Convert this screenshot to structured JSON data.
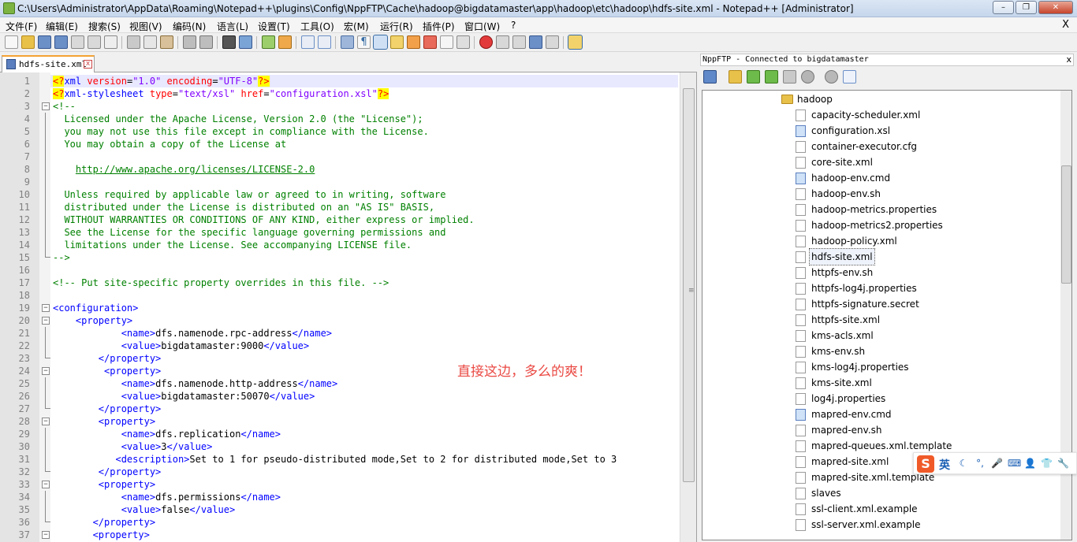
{
  "window": {
    "title": "C:\\Users\\Administrator\\AppData\\Roaming\\Notepad++\\plugins\\Config\\NppFTP\\Cache\\hadoop@bigdatamaster\\app\\hadoop\\etc\\hadoop\\hdfs-site.xml - Notepad++ [Administrator]",
    "minimize": "–",
    "maximize": "❐",
    "close": "✕"
  },
  "menu": {
    "items": [
      "文件(F)",
      "编辑(E)",
      "搜索(S)",
      "视图(V)",
      "编码(N)",
      "语言(L)",
      "设置(T)",
      "工具(O)",
      "宏(M)",
      "运行(R)",
      "插件(P)",
      "窗口(W)",
      "?"
    ],
    "close": "X"
  },
  "tab": {
    "label": "hdfs-site.xml",
    "close": "x"
  },
  "editor": {
    "lines": [
      "<span class=\"p\">&lt;?</span><span class=\"t\">xml</span> <span class=\"a\">version</span>=<span class=\"s\">\"1.0\"</span> <span class=\"a\">encoding</span>=<span class=\"s\">\"UTF-8\"</span><span class=\"p\">?&gt;</span>",
      "<span class=\"p\">&lt;?</span><span class=\"t\">xml-stylesheet</span> <span class=\"a\">type</span>=<span class=\"s\">\"text/xsl\"</span> <span class=\"a\">href</span>=<span class=\"s\">\"configuration.xsl\"</span><span class=\"p\">?&gt;</span>",
      "<span class=\"c\">&lt;!--</span>",
      "<span class=\"c\">  Licensed under the Apache License, Version 2.0 (the \"License\");</span>",
      "<span class=\"c\">  you may not use this file except in compliance with the License.</span>",
      "<span class=\"c\">  You may obtain a copy of the License at</span>",
      "",
      "<span class=\"c\">    </span><span class=\"u\">http://www.apache.org/licenses/LICENSE-2.0</span>",
      "",
      "<span class=\"c\">  Unless required by applicable law or agreed to in writing, software</span>",
      "<span class=\"c\">  distributed under the License is distributed on an \"AS IS\" BASIS,</span>",
      "<span class=\"c\">  WITHOUT WARRANTIES OR CONDITIONS OF ANY KIND, either express or implied.</span>",
      "<span class=\"c\">  See the License for the specific language governing permissions and</span>",
      "<span class=\"c\">  limitations under the License. See accompanying LICENSE file.</span>",
      "<span class=\"c\">--&gt;</span>",
      "",
      "<span class=\"c\">&lt;!-- Put site-specific property overrides in this file. --&gt;</span>",
      "",
      "<span class=\"t\">&lt;configuration&gt;</span>",
      "    <span class=\"t\">&lt;property&gt;</span>",
      "            <span class=\"t\">&lt;name&gt;</span>dfs.namenode.rpc-address<span class=\"t\">&lt;/name&gt;</span>",
      "            <span class=\"t\">&lt;value&gt;</span>bigdatamaster:9000<span class=\"t\">&lt;/value&gt;</span>",
      "        <span class=\"t\">&lt;/property&gt;</span>",
      "         <span class=\"t\">&lt;property&gt;</span>",
      "            <span class=\"t\">&lt;name&gt;</span>dfs.namenode.http-address<span class=\"t\">&lt;/name&gt;</span>",
      "            <span class=\"t\">&lt;value&gt;</span>bigdatamaster:50070<span class=\"t\">&lt;/value&gt;</span>",
      "        <span class=\"t\">&lt;/property&gt;</span>",
      "        <span class=\"t\">&lt;property&gt;</span>",
      "            <span class=\"t\">&lt;name&gt;</span>dfs.replication<span class=\"t\">&lt;/name&gt;</span>",
      "            <span class=\"t\">&lt;value&gt;</span>3<span class=\"t\">&lt;/value&gt;</span>",
      "           <span class=\"t\">&lt;description&gt;</span>Set to 1 for pseudo-distributed mode,Set to 2 for distributed mode,Set to 3",
      "        <span class=\"t\">&lt;/property&gt;</span>",
      "        <span class=\"t\">&lt;property&gt;</span>",
      "            <span class=\"t\">&lt;name&gt;</span>dfs.permissions<span class=\"t\">&lt;/name&gt;</span>",
      "            <span class=\"t\">&lt;value&gt;</span>false<span class=\"t\">&lt;/value&gt;</span>",
      "       <span class=\"t\">&lt;/property&gt;</span>",
      "       <span class=\"t\">&lt;property&gt;</span>"
    ],
    "folds": [
      "",
      "",
      "minus",
      "line",
      "line",
      "line",
      "line",
      "line",
      "line",
      "line",
      "line",
      "line",
      "line",
      "line",
      "end",
      "",
      "",
      "",
      "minus",
      "minus",
      "line",
      "line",
      "end",
      "minus",
      "line",
      "line",
      "end",
      "minus",
      "line",
      "line",
      "line",
      "end",
      "minus",
      "line",
      "line",
      "end",
      "minus"
    ]
  },
  "annotation": {
    "text": "直接这边，多么的爽！",
    "color": "#ea4a44"
  },
  "nppftp": {
    "title": "NppFTP - Connected to bigdatamaster",
    "close": "x",
    "folder": "hadoop",
    "files": [
      "capacity-scheduler.xml",
      "configuration.xsl",
      "container-executor.cfg",
      "core-site.xml",
      "hadoop-env.cmd",
      "hadoop-env.sh",
      "hadoop-metrics.properties",
      "hadoop-metrics2.properties",
      "hadoop-policy.xml",
      "hdfs-site.xml",
      "httpfs-env.sh",
      "httpfs-log4j.properties",
      "httpfs-signature.secret",
      "httpfs-site.xml",
      "kms-acls.xml",
      "kms-env.sh",
      "kms-log4j.properties",
      "kms-site.xml",
      "log4j.properties",
      "mapred-env.cmd",
      "mapred-env.sh",
      "mapred-queues.xml.template",
      "mapred-site.xml",
      "mapred-site.xml.template",
      "slaves",
      "ssl-client.xml.example",
      "ssl-server.xml.example"
    ],
    "special_icons": [
      "configuration.xsl",
      "hadoop-env.cmd",
      "mapred-env.cmd"
    ],
    "selected": "hdfs-site.xml"
  },
  "ime": {
    "logo": "S",
    "lang": "英",
    "icons": [
      "moon-icon",
      "punct-icon",
      "mic-icon",
      "keyboard-icon",
      "user-icon",
      "shirt-icon",
      "wrench-icon"
    ],
    "glyphs": [
      "☾",
      "°,",
      "🎤",
      "⌨",
      "👤",
      "👕",
      "🔧"
    ]
  },
  "colors": {
    "accent": "#f4a234",
    "tag": "#0000ff",
    "comment": "#008000",
    "attr": "#ff0000",
    "string": "#8000ff"
  }
}
